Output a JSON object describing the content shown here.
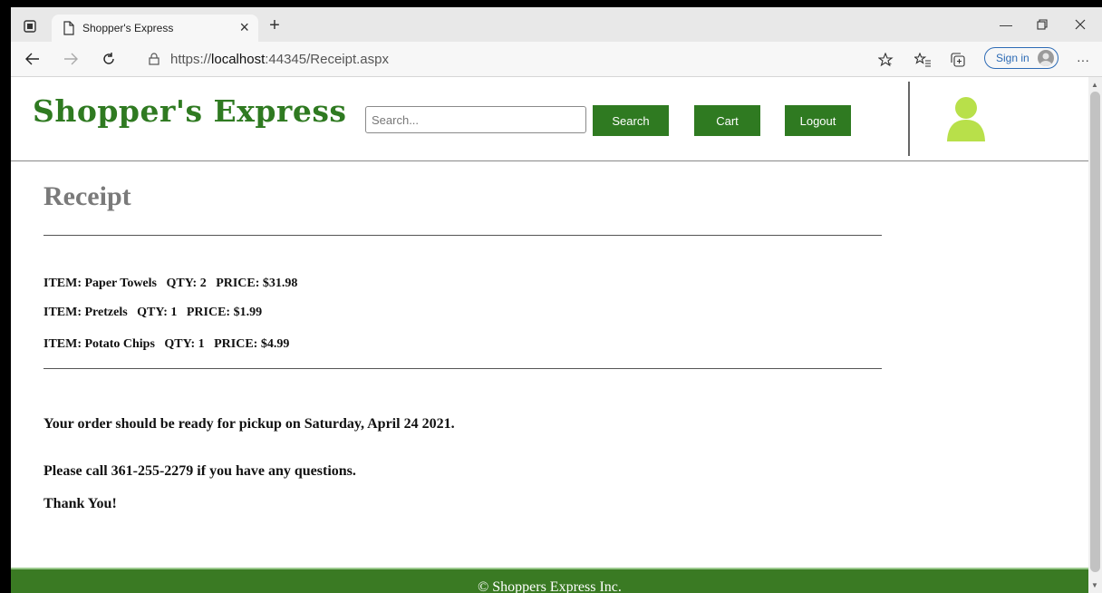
{
  "browser": {
    "tab_title": "Shopper's Express",
    "url_prefix": "https://",
    "url_host": "localhost",
    "url_rest": ":44345/Receipt.aspx",
    "signin_label": "Sign in"
  },
  "header": {
    "logo": "Shopper's Express",
    "search_placeholder": "Search...",
    "search_button": "Search",
    "cart_button": "Cart",
    "logout_button": "Logout"
  },
  "receipt": {
    "title": "Receipt",
    "items": [
      {
        "text": "ITEM: Paper Towels   QTY: 2   PRICE: $31.98"
      },
      {
        "text": "ITEM: Pretzels   QTY: 1   PRICE: $1.99"
      },
      {
        "text": "ITEM: Potato Chips   QTY: 1   PRICE: $4.99"
      }
    ],
    "pickup_message": "Your order should be ready for pickup on Saturday, April 24 2021.",
    "call_message": "Please call 361-255-2279 if you have any questions.",
    "thanks": "Thank You!"
  },
  "footer": {
    "text": "© Shoppers Express Inc."
  },
  "colors": {
    "brand_green": "#2f7a21",
    "footer_green": "#3a7a23",
    "user_icon": "#b8e04a"
  },
  "icons": [
    "tab-actions-icon",
    "page-icon",
    "close-icon",
    "plus-icon",
    "back-arrow-icon",
    "forward-arrow-icon",
    "refresh-icon",
    "lock-icon",
    "favorite-star-icon",
    "favorites-icon",
    "collections-icon",
    "more-icon",
    "user-icon"
  ]
}
